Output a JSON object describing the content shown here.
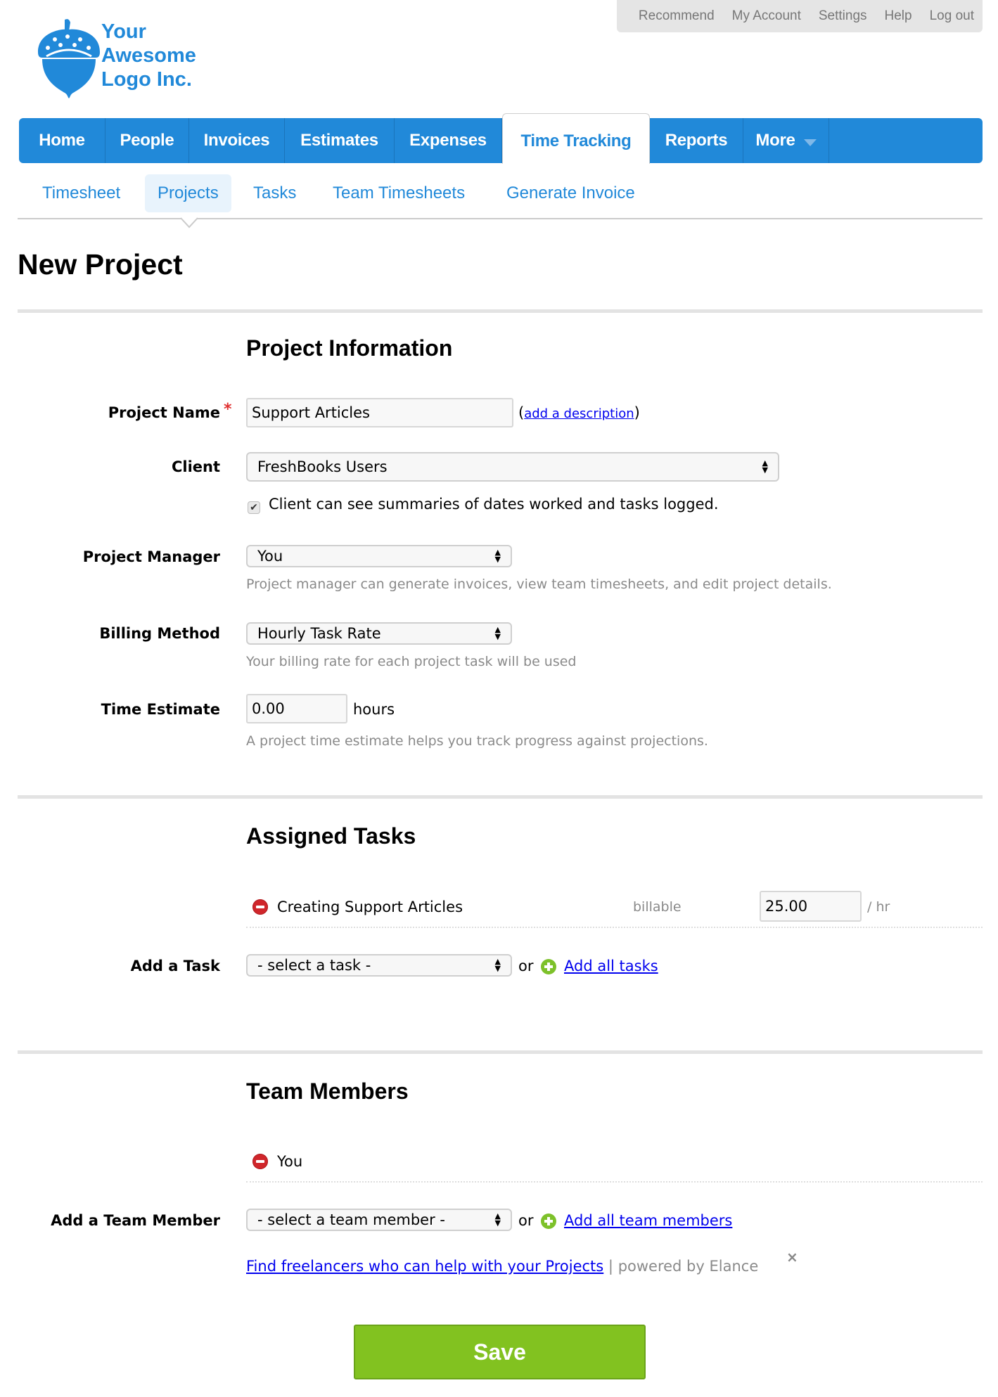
{
  "top_links": [
    "Recommend",
    "My Account",
    "Settings",
    "Help",
    "Log out"
  ],
  "logo": {
    "lines": [
      "Your",
      "Awesome",
      "Logo Inc."
    ],
    "icon": "acorn-icon",
    "color": "#2189d9"
  },
  "main_nav": {
    "tabs": [
      {
        "label": "Home"
      },
      {
        "label": "People"
      },
      {
        "label": "Invoices"
      },
      {
        "label": "Estimates"
      },
      {
        "label": "Expenses"
      },
      {
        "label": "Time Tracking",
        "active": true
      },
      {
        "label": "Reports"
      },
      {
        "label": "More",
        "has_dropdown": true
      }
    ],
    "color": "#2189d9"
  },
  "sub_nav": {
    "items": [
      {
        "label": "Timesheet"
      },
      {
        "label": "Projects",
        "active": true
      },
      {
        "label": "Tasks"
      },
      {
        "label": "Team Timesheets"
      },
      {
        "label": "Generate Invoice"
      }
    ]
  },
  "page_title": "New Project",
  "project_information": {
    "title": "Project Information",
    "project_name": {
      "label": "Project Name",
      "required_mark": "*",
      "value": "Support Articles",
      "add_description_link": "add a description",
      "paren_open": "(",
      "paren_close": ")"
    },
    "client": {
      "label": "Client",
      "selected": "FreshBooks Users"
    },
    "client_visibility": {
      "checked": true,
      "label": "Client can see summaries of dates worked and tasks logged."
    },
    "project_manager": {
      "label": "Project Manager",
      "selected": "You",
      "hint": "Project manager can generate invoices, view team timesheets, and edit project details."
    },
    "billing_method": {
      "label": "Billing Method",
      "selected": "Hourly Task Rate",
      "hint": "Your billing rate for each project task will be used"
    },
    "time_estimate": {
      "label": "Time Estimate",
      "value": "0.00",
      "unit": "hours",
      "hint": "A project time estimate helps you track progress against projections."
    }
  },
  "assigned_tasks": {
    "title": "Assigned Tasks",
    "tasks": [
      {
        "name": "Creating Support Articles",
        "billable_label": "billable",
        "rate": "25.00",
        "rate_unit": "/ hr"
      }
    ],
    "add_task": {
      "label": "Add a Task",
      "placeholder_option": "- select a task -",
      "or": "or",
      "add_all_link": "Add all tasks"
    }
  },
  "team_members": {
    "title": "Team Members",
    "members": [
      {
        "name": "You"
      }
    ],
    "add_member": {
      "label": "Add a Team Member",
      "placeholder_option": "- select a team member -",
      "or": "or",
      "add_all_link": "Add all team members"
    },
    "freelancer_link": "Find freelancers who can help with your Projects",
    "separator": "|",
    "powered_by": "powered by Elance",
    "close": "×"
  },
  "save_label": "Save",
  "colors": {
    "accent": "#2189d9",
    "save": "#82c220",
    "remove": "#d0262b",
    "add": "#7dc12a",
    "required": "#e03030"
  }
}
